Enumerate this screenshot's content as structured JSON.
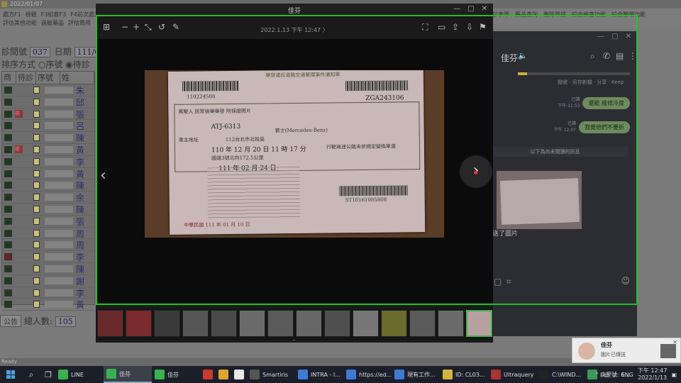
{
  "background_app": {
    "title": "2022/01/07",
    "menu_row1": [
      "處方F1",
      "檢驗",
      "F3組套F3",
      "F4前次處方"
    ],
    "menu_row2": [
      "評估其他功能",
      "過敏藥品",
      "評估費用"
    ],
    "menu_right": [
      "看診表單",
      "藥品查詢",
      "刪除單據",
      "綜合檢查功能",
      "綜合醫囑功能"
    ],
    "clinic_label": "診間號",
    "clinic_no": "037",
    "date_label": "日期",
    "date_value": "111/01/",
    "sort_label": "排序方式",
    "sort_option1": "○序號",
    "sort_option2": "◉待診",
    "grid_headers": [
      "商",
      "待診",
      "序號",
      "姓"
    ],
    "grid_rows": [
      {
        "name": "朱",
        "flag": "",
        "chk": "green"
      },
      {
        "name": "邱",
        "flag": "",
        "chk": "green"
      },
      {
        "name": "張",
        "flag": "複",
        "chk": "green"
      },
      {
        "name": "呂",
        "flag": "",
        "chk": "green"
      },
      {
        "name": "陳",
        "flag": "",
        "chk": "green"
      },
      {
        "name": "黃",
        "flag": "複",
        "chk": "green"
      },
      {
        "name": "李",
        "flag": "",
        "chk": "green"
      },
      {
        "name": "黃",
        "flag": "",
        "chk": "green"
      },
      {
        "name": "陳",
        "flag": "",
        "chk": "green"
      },
      {
        "name": "余",
        "flag": "",
        "chk": "green"
      },
      {
        "name": "陳",
        "flag": "",
        "chk": "green"
      },
      {
        "name": "張",
        "flag": "",
        "chk": "green"
      },
      {
        "name": "周",
        "flag": "",
        "chk": "green"
      },
      {
        "name": "周",
        "flag": "",
        "chk": "green"
      },
      {
        "name": "李",
        "flag": "",
        "chk": "red"
      },
      {
        "name": "陳",
        "flag": "",
        "chk": "green"
      },
      {
        "name": "謝",
        "flag": "",
        "chk": "green"
      },
      {
        "name": "李",
        "flag": "",
        "chk": "green"
      },
      {
        "name": "黃",
        "flag": "",
        "chk": "green"
      }
    ],
    "total_label": "公告",
    "total_text": "總人數:",
    "total_value": "105",
    "status": "Ready"
  },
  "chat": {
    "contact_name": "佳芬",
    "tools": "撥號 · 另存新檔 · 分享 · Keep",
    "messages": [
      {
        "read": "已讀",
        "time": "下午 11:53",
        "text": "還能 維修冷度"
      },
      {
        "read": "已讀",
        "time": "下午 12:07",
        "text": "我覺他們不要折"
      }
    ],
    "unread_divider": "以下為尚未閱讀的訊息",
    "sent_image_text": "送了圖片"
  },
  "viewer": {
    "window_title": "佳芬",
    "date_text": "2022.1.13 下午 12:47 〉",
    "toolbar_left": [
      "grid-icon",
      "zoom-out-icon",
      "zoom-in-icon",
      "expand-icon",
      "rotate-icon",
      "edit-icon"
    ],
    "toolbar_right": [
      "scan-icon",
      "fullscreen-icon",
      "share-icon",
      "download-icon",
      "bookmark-icon"
    ],
    "photo": {
      "header": "舉發違反道路交通管理事件通知單",
      "ticket_no": "ZGA243106",
      "left_no": "110224508",
      "plate": "ATJ-6313",
      "vehicle": "賓士(Mercedes-Benz)",
      "date_line": "110 年 12 月 20 日 11 時 17 分",
      "place": "國道3號北向172.5公里",
      "deadline": "111 年 02 月 24 日",
      "law_text": "行駛高速公路未依規定變換車道",
      "bottom": "中華民國 111 年 01 月 10 日",
      "barcode_text": "ST10161085808",
      "ticket_type": "駕駛人 民眾檢舉舉發 附採證照片",
      "owner_label": "車主地址",
      "address": "112台北市北投區"
    },
    "thumb_count": 14,
    "selected_thumb": 13
  },
  "toast": {
    "title": "佳芬",
    "body": "圖片已傳送"
  },
  "taskbar": {
    "items": [
      {
        "label": "LINE",
        "color": "#36b34a",
        "wide": true,
        "active": false
      },
      {
        "label": "佳芬",
        "color": "#36b34a",
        "wide": true,
        "active": true
      },
      {
        "label": "佳芬",
        "color": "#36b34a",
        "wide": true,
        "active": false
      },
      {
        "label": "",
        "color": "#c93a2a",
        "wide": false,
        "active": false
      },
      {
        "label": "",
        "color": "#e0a52a",
        "wide": false,
        "active": false
      },
      {
        "label": "",
        "color": "#e8e8e8",
        "wide": false,
        "active": false
      },
      {
        "label": "Smartiris",
        "color": "#555",
        "wide": true,
        "active": false
      },
      {
        "label": "INTRA - I...",
        "color": "#3a7bd5",
        "wide": true,
        "active": false
      },
      {
        "label": "https://ed...",
        "color": "#3a7bd5",
        "wide": true,
        "active": false
      },
      {
        "label": "現有工作...",
        "color": "#3a7bd5",
        "wide": true,
        "active": false
      },
      {
        "label": "ID: CL03...",
        "color": "#d6b43a",
        "wide": true,
        "active": false
      },
      {
        "label": "Ultraquery",
        "color": "#a33",
        "wide": true,
        "active": false
      },
      {
        "label": "C:\\WIND...",
        "color": "#222",
        "wide": true,
        "active": false
      },
      {
        "label": "病歷號: 6...",
        "color": "#3a9a5a",
        "wide": true,
        "active": false
      }
    ],
    "lang": "ENG",
    "time": "下午 12:47",
    "date": "2022/1/13"
  }
}
